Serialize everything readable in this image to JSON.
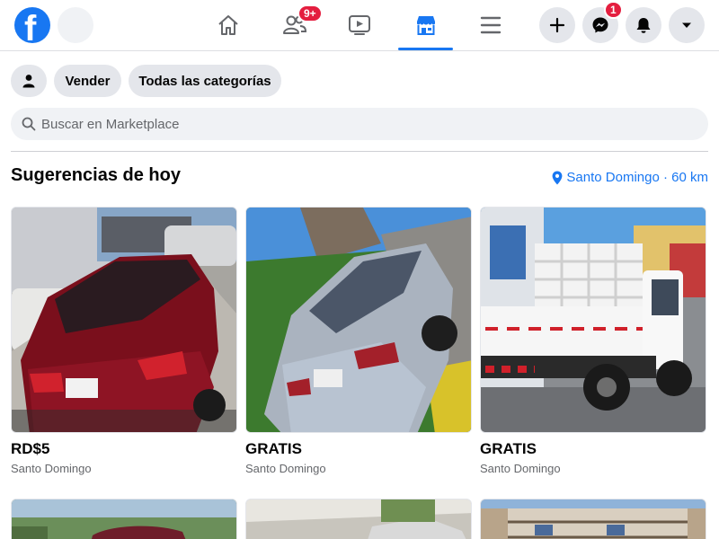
{
  "nav": {
    "logo": "f",
    "friends_badge": "9+",
    "messenger_badge": "1",
    "tabs": [
      "home-icon",
      "friends-icon",
      "watch-icon",
      "marketplace-icon",
      "menu-icon"
    ],
    "accent": "#1877f2"
  },
  "filters": {
    "profile_icon": "person-icon",
    "sell_label": "Vender",
    "categories_label": "Todas las categorías"
  },
  "search": {
    "placeholder": "Buscar en Marketplace"
  },
  "section": {
    "title": "Sugerencias de hoy",
    "location": "Santo Domingo · 60 km"
  },
  "listings": [
    {
      "price": "RD$5",
      "location": "Santo Domingo",
      "image": "red sedan car"
    },
    {
      "price": "GRATIS",
      "location": "Santo Domingo",
      "image": "silver sedan car"
    },
    {
      "price": "GRATIS",
      "location": "Santo Domingo",
      "image": "white pickup truck"
    }
  ]
}
